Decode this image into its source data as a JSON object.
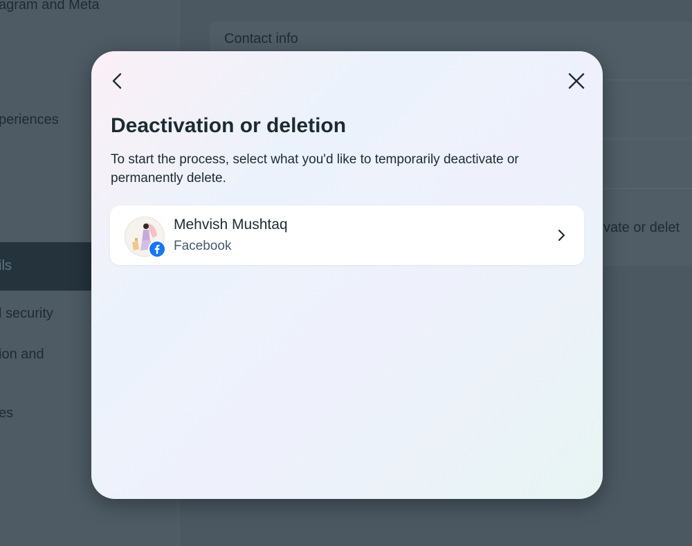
{
  "background": {
    "sidebar_items": [
      "agram and Meta",
      "periences",
      "ils",
      "l security",
      "ion and",
      "es"
    ],
    "main": {
      "contact_info": "Contact info",
      "partial_row": "tivate or delet"
    }
  },
  "modal": {
    "back_icon": "chevron-left-icon",
    "close_icon": "close-icon",
    "title": "Deactivation or deletion",
    "description": "To start the process, select what you'd like to temporarily deactivate or permanently delete.",
    "account": {
      "name": "Mehvish Mushtaq",
      "platform": "Facebook",
      "platform_icon": "facebook-icon",
      "chevron_icon": "chevron-right-icon"
    }
  },
  "colors": {
    "facebook_blue": "#1877f2",
    "text_primary": "#1c2b33",
    "overlay": "#4b5862"
  }
}
